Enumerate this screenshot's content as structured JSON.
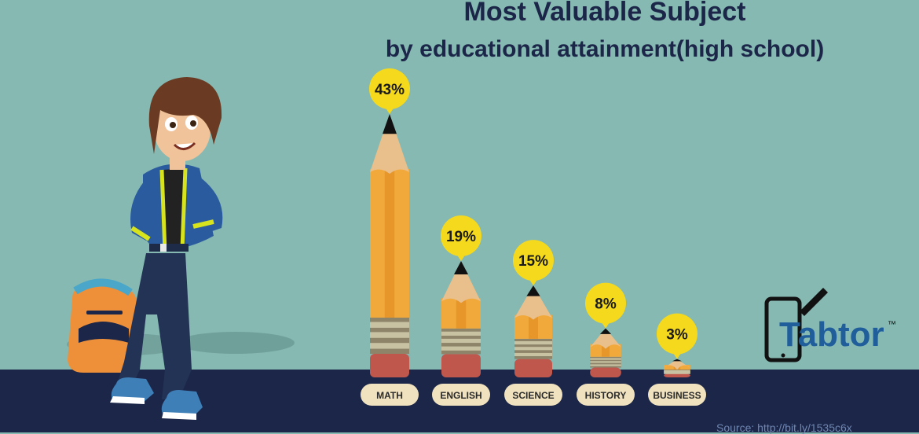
{
  "chart_data": {
    "type": "bar",
    "title": "Most Valuable Subject",
    "subtitle": "by educational attainment(high school)",
    "categories": [
      "MATH",
      "ENGLISH",
      "SCIENCE",
      "HISTORY",
      "BUSINESS"
    ],
    "values": [
      43,
      19,
      15,
      8,
      3
    ],
    "value_labels": [
      "43%",
      "19%",
      "15%",
      "8%",
      "3%"
    ],
    "unit": "%"
  },
  "brand": {
    "logo_text": "Tabtor",
    "trademark": "™"
  },
  "source": "Source: http://bit.ly/1535c6x",
  "colors": {
    "background": "#86b9b2",
    "floor": "#1b2648",
    "title": "#1b2648",
    "pencil_body": "#f2a93b",
    "pencil_stripe": "#e08a1e",
    "wood": "#e9c08c",
    "lead": "#111111",
    "ferrule": "#8d8469",
    "eraser": "#c0574d",
    "value_bubble": "#f5d91c",
    "label_pill": "#f0e2bf"
  },
  "icons": [
    "student-character-icon",
    "backpack-icon",
    "tablet-pen-logo-icon",
    "pencil-icon"
  ]
}
